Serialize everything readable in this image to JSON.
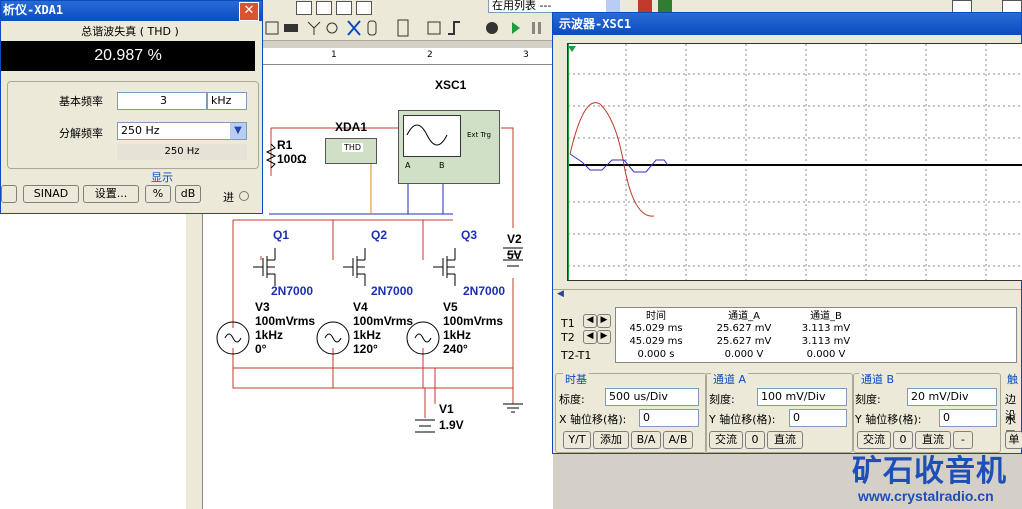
{
  "toolbar": {
    "instrument_list": "在用列表 ---"
  },
  "thd": {
    "title": "析仪-XDA1",
    "heading": "总谐波失真 ( THD )",
    "value": "20.987 %",
    "fundamental_label": "基本频率",
    "fundamental_value": "3",
    "fundamental_unit": "kHz",
    "resolution_label": "分解频率",
    "resolution_value": "250 Hz",
    "resolution_readout": "250 Hz",
    "display_label": "显示",
    "sinad_btn": "SINAD",
    "settings_btn": "设置...",
    "percent_btn": "%",
    "db_btn": "dB",
    "in_label": "进"
  },
  "ruler": {
    "marks": [
      "1",
      "2",
      "3"
    ]
  },
  "circuit": {
    "xsc_label": "XSC1",
    "xda_label": "XDA1",
    "thd_box": "THD",
    "ext_trig": "Ext Trg",
    "chA": "A",
    "chB": "B",
    "r1": "R1",
    "r1_val": "100Ω",
    "q1": "Q1",
    "q2": "Q2",
    "q3": "Q3",
    "part": "2N7000",
    "v2": "V2",
    "v2_val": "5V",
    "v3": "V3",
    "v4": "V4",
    "v5": "V5",
    "vrms": "100mVrms",
    "freq": "1kHz",
    "ph3": "0°",
    "ph4": "120°",
    "ph5": "240°",
    "v1": "V1",
    "v1_val": "1.9V"
  },
  "scope": {
    "title": "示波器-XSC1",
    "col_time": "时间",
    "col_a": "通道_A",
    "col_b": "通道_B",
    "t1": "T1",
    "t2": "T2",
    "t21": "T2-T1",
    "rows": [
      [
        "45.029 ms",
        "25.627 mV",
        "3.113 mV"
      ],
      [
        "45.029 ms",
        "25.627 mV",
        "3.113 mV"
      ],
      [
        "0.000 s",
        "0.000 V",
        "0.000 V"
      ]
    ],
    "timebase": "时基",
    "scale_label": "标度:",
    "timebase_value": "500 us/Div",
    "xpos_label": "X 轴位移(格):",
    "xpos_value": "0",
    "yt": "Y/T",
    "add": "添加",
    "ba": "B/A",
    "ab": "A/B",
    "cha_title": "通道 A",
    "cha_scale_label": "刻度:",
    "cha_scale": "100 mV/Div",
    "cha_ypos_label": "Y 轴位移(格):",
    "cha_ypos": "0",
    "ac": "交流",
    "zero": "0",
    "dc": "直流",
    "chb_title": "通道 B",
    "chb_scale_label": "刻度:",
    "chb_scale": "20 mV/Div",
    "chb_ypos_label": "Y 轴位移(格):",
    "chb_ypos": "0",
    "minus": "-",
    "trigger": "触",
    "edge": "边沿",
    "level": "水平",
    "single": "单"
  },
  "watermark": {
    "cn": "矿石收音机",
    "url": "www.crystalradio.cn"
  }
}
